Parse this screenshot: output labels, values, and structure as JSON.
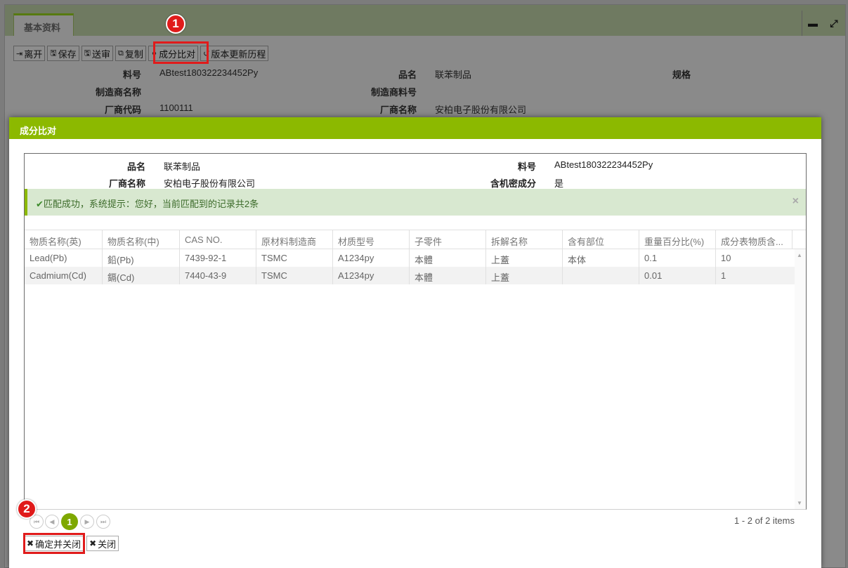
{
  "background": {
    "tab_label": "基本资料",
    "window_buttons": {
      "minimize": "▬",
      "maximize": "⤢"
    },
    "toolbar": [
      {
        "label": "离开",
        "icon": "exit-icon",
        "glyph": "⇥"
      },
      {
        "label": "保存",
        "icon": "save-icon",
        "glyph": "🖫"
      },
      {
        "label": "送审",
        "icon": "submit-icon",
        "glyph": "🖫"
      },
      {
        "label": "复制",
        "icon": "copy-icon",
        "glyph": "⧉"
      },
      {
        "label": "成分比对",
        "icon": "link-icon",
        "glyph": "⚭"
      },
      {
        "label": "版本更新历程",
        "icon": "history-icon",
        "glyph": "↺"
      }
    ],
    "fields": {
      "part_no_label": "料号",
      "part_no": "ABtest180322234452Py",
      "product_name_label": "品名",
      "product_name": "联苯制品",
      "spec_label": "规格",
      "maker_name_label": "制造商名称",
      "maker_part_label": "制造商料号",
      "vendor_code_label": "厂商代码",
      "vendor_code": "1100111",
      "vendor_name_label": "厂商名称",
      "vendor_name": "安柏电子股份有限公司"
    }
  },
  "annotations": {
    "badge1": "1",
    "badge2": "2"
  },
  "modal": {
    "title": "成分比对",
    "info": {
      "product_name_label": "品名",
      "product_name": "联苯制品",
      "part_no_label": "料号",
      "part_no": "ABtest180322234452Py",
      "vendor_name_label": "厂商名称",
      "vendor_name": "安柏电子股份有限公司",
      "confidential_label": "含机密成分",
      "confidential": "是"
    },
    "alert": {
      "check": "✔",
      "text": "匹配成功，系统提示：您好，当前匹配到的记录共2条",
      "close": "×"
    },
    "grid": {
      "columns": [
        "物质名称(英)",
        "物质名称(中)",
        "CAS NO.",
        "原材料制造商",
        "材质型号",
        "子零件",
        "拆解名称",
        "含有部位",
        "重量百分比(%)",
        "成分表物质含..."
      ],
      "rows": [
        [
          "Lead(Pb)",
          "鉛(Pb)",
          "7439-92-1",
          "TSMC",
          "A1234py",
          "本體",
          "上蓋",
          "本体",
          "0.1",
          "10"
        ],
        [
          "Cadmium(Cd)",
          "鎘(Cd)",
          "7440-43-9",
          "TSMC",
          "A1234py",
          "本體",
          "上蓋",
          "",
          "0.01",
          "1"
        ]
      ]
    },
    "pager": {
      "first": "⏮",
      "prev": "◀",
      "current": "1",
      "next": "▶",
      "last": "⏭",
      "info": "1 - 2 of 2 items"
    },
    "buttons": {
      "confirm": "确定并关闭",
      "close": "关闭",
      "x": "✖"
    }
  }
}
